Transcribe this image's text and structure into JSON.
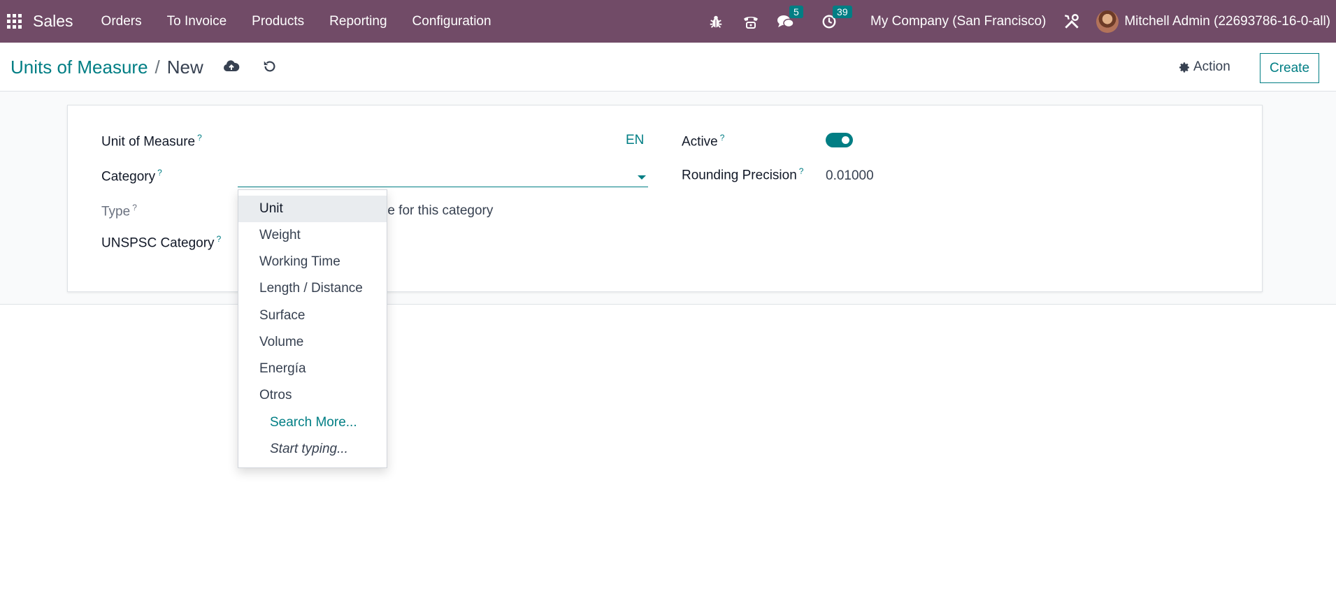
{
  "navbar": {
    "brand": "Sales",
    "menu": [
      "Orders",
      "To Invoice",
      "Products",
      "Reporting",
      "Configuration"
    ],
    "messages_count": "5",
    "activities_count": "39",
    "company": "My Company (San Francisco)",
    "user": "Mitchell Admin (22693786-16-0-all)",
    "icons": [
      "apps-grid-icon",
      "bug-icon",
      "phone-icon",
      "chat-icon",
      "clock-icon",
      "tools-icon"
    ]
  },
  "control_panel": {
    "breadcrumb_parent": "Units of Measure",
    "breadcrumb_sep": "/",
    "breadcrumb_current": "New",
    "action_label": "Action",
    "create_label": "Create"
  },
  "form": {
    "uom_label": "Unit of Measure",
    "lang": "EN",
    "category_label": "Category",
    "type_label": "Type",
    "type_value": "re for this category",
    "unspsc_label": "UNSPSC Category",
    "active_label": "Active",
    "active": true,
    "rounding_label": "Rounding Precision",
    "rounding_value": "0.01000",
    "help_mark": "?"
  },
  "dropdown": {
    "options": [
      "Unit",
      "Weight",
      "Working Time",
      "Length / Distance",
      "Surface",
      "Volume",
      "Energía",
      "Otros"
    ],
    "highlighted": "Unit",
    "search_more": "Search More...",
    "start_typing": "Start typing..."
  },
  "colors": {
    "navbar": "#714B67",
    "accent": "#017E84"
  }
}
